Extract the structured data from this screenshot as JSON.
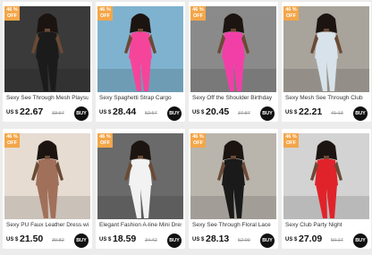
{
  "products": [
    {
      "badge": "46 % OFF",
      "title": "Sexy See Through Mesh Playsuit",
      "currency": "US $",
      "price": "22.67",
      "old_price": "33.67",
      "buy": "BUY",
      "bg": "#3a3a3a",
      "outfit": "#1b1b1b",
      "scene": "dark-street"
    },
    {
      "badge": "46 % OFF",
      "title": "Sexy Spaghetti Strap Cargo",
      "currency": "US $",
      "price": "28.44",
      "old_price": "52.67",
      "buy": "BUY",
      "bg": "#7fb2cf",
      "outfit": "#f5459a",
      "scene": "pool"
    },
    {
      "badge": "46 % OFF",
      "title": "Sexy Off the Shoulder Birthday",
      "currency": "US $",
      "price": "20.45",
      "old_price": "37.87",
      "buy": "BUY",
      "bg": "#8a8a8a",
      "outfit": "#f23fa8",
      "scene": "plain"
    },
    {
      "badge": "46 % OFF",
      "title": "Sexy Mesh See Through Club",
      "currency": "US $",
      "price": "22.21",
      "old_price": "41.13",
      "buy": "BUY",
      "bg": "#a8a39b",
      "outfit": "#d8e2ea",
      "scene": "outdoor"
    },
    {
      "badge": "46 % OFF",
      "title": "Sexy PU Faux Leather Dress with",
      "currency": "US $",
      "price": "21.50",
      "old_price": "39.82",
      "buy": "BUY",
      "bg": "#e6dcd2",
      "outfit": "#a0705a",
      "scene": "studio"
    },
    {
      "badge": "46 % OFF",
      "title": "Elegant Fashion A-line Mini Dress",
      "currency": "US $",
      "price": "18.59",
      "old_price": "34.42",
      "buy": "BUY",
      "bg": "#6a6a6a",
      "outfit": "#f2f2f2",
      "scene": "stairs"
    },
    {
      "badge": "46 % OFF",
      "title": "Sexy See Through Floral Lace",
      "currency": "US $",
      "price": "28.13",
      "old_price": "52.09",
      "buy": "BUY",
      "bg": "#b9b4ac",
      "outfit": "#1a1a1a",
      "scene": "hall"
    },
    {
      "badge": "46 % OFF",
      "title": "Sexy Club Party Night",
      "currency": "US $",
      "price": "27.09",
      "old_price": "50.17",
      "buy": "BUY",
      "bg": "#d3d3d3",
      "outfit": "#e0232b",
      "scene": "plain-light"
    }
  ]
}
